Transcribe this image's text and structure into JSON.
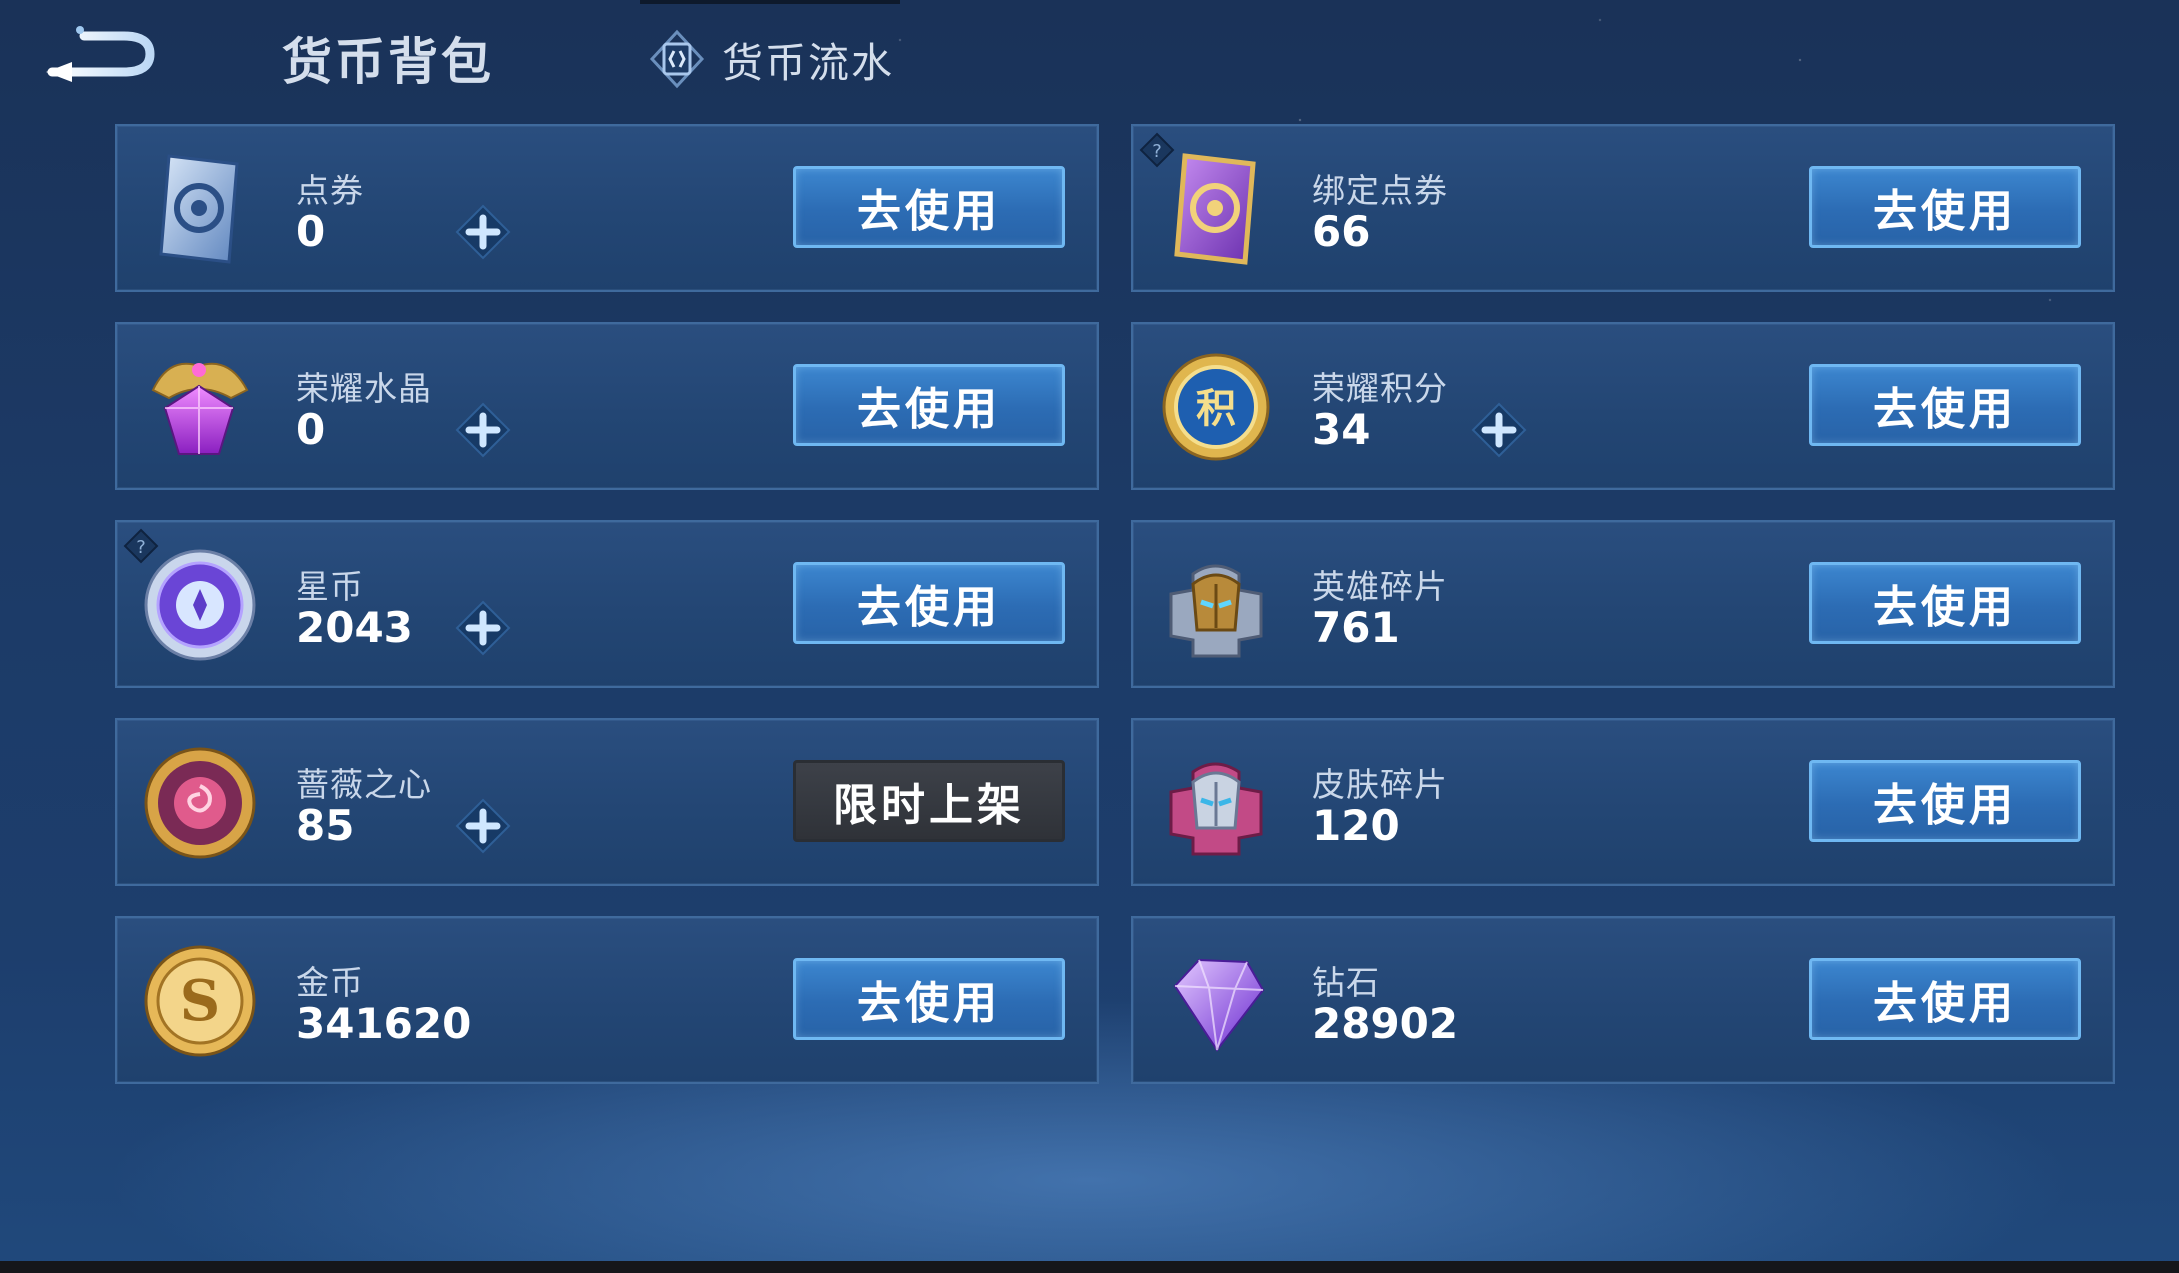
{
  "header": {
    "title": "货币背包",
    "flow_tab_label": "货币流水"
  },
  "colors": {
    "accent_button": "#2c6cb4",
    "button_border": "#6fb8f2",
    "disabled_button": "#33363c",
    "card_bg": "#234674"
  },
  "currencies": [
    {
      "name": "点券",
      "amount": "0",
      "icon": "voucher-icon",
      "action": "去使用",
      "has_plus": true,
      "has_help": false
    },
    {
      "name": "绑定点券",
      "amount": "66",
      "icon": "bound-voucher-icon",
      "action": "去使用",
      "has_plus": false,
      "has_help": true
    },
    {
      "name": "荣耀水晶",
      "amount": "0",
      "icon": "glory-crystal-icon",
      "action": "去使用",
      "has_plus": true,
      "has_help": false
    },
    {
      "name": "荣耀积分",
      "amount": "34",
      "icon": "glory-points-icon",
      "action": "去使用",
      "has_plus": true,
      "has_help": false
    },
    {
      "name": "星币",
      "amount": "2043",
      "icon": "star-coin-icon",
      "action": "去使用",
      "has_plus": true,
      "has_help": true
    },
    {
      "name": "英雄碎片",
      "amount": "761",
      "icon": "hero-fragment-icon",
      "action": "去使用",
      "has_plus": false,
      "has_help": false
    },
    {
      "name": "蔷薇之心",
      "amount": "85",
      "icon": "rose-heart-icon",
      "action": "限时上架",
      "has_plus": true,
      "has_help": false
    },
    {
      "name": "皮肤碎片",
      "amount": "120",
      "icon": "skin-fragment-icon",
      "action": "去使用",
      "has_plus": false,
      "has_help": false
    },
    {
      "name": "金币",
      "amount": "341620",
      "icon": "gold-coin-icon",
      "action": "去使用",
      "has_plus": false,
      "has_help": false
    },
    {
      "name": "钻石",
      "amount": "28902",
      "icon": "diamond-icon",
      "action": "去使用",
      "has_plus": false,
      "has_help": false
    }
  ]
}
